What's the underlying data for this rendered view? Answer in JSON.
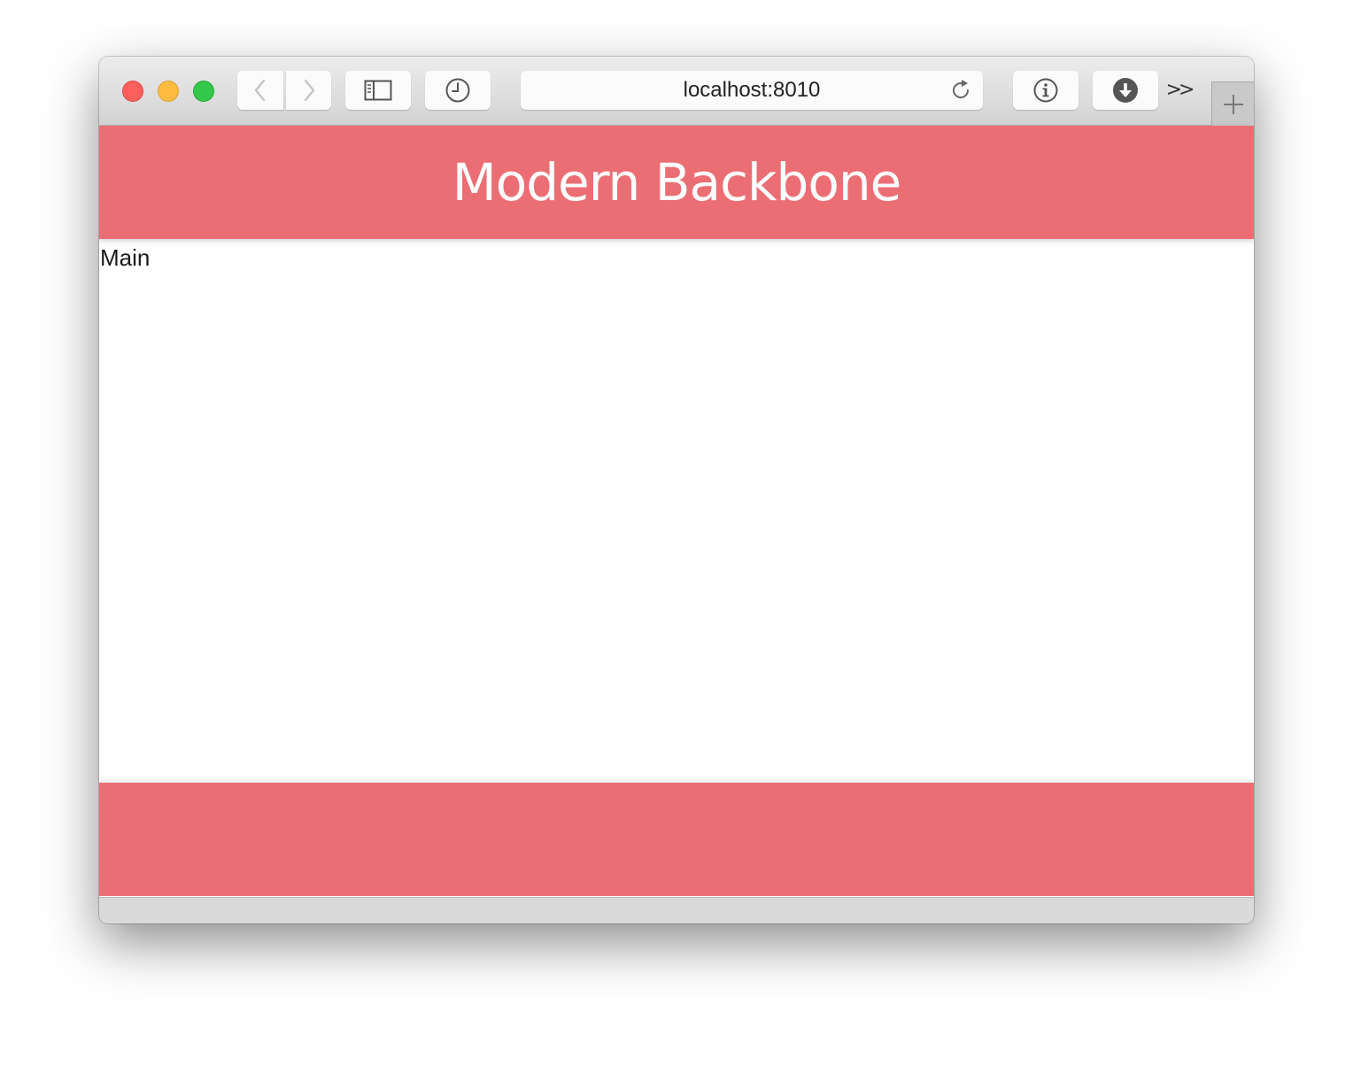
{
  "browser": {
    "url": "localhost:8010",
    "icons": {
      "back": "chevron-left-icon",
      "forward": "chevron-right-icon",
      "sidebar": "sidebar-icon",
      "history": "clock-icon",
      "reload": "reload-icon",
      "info": "info-icon",
      "download": "download-icon",
      "more": "double-chevron-right-icon",
      "new_tab": "plus-icon"
    },
    "more_label": ">>"
  },
  "app": {
    "title": "Modern Backbone",
    "main_label": "Main",
    "colors": {
      "header": "#eb6e74",
      "footer": "#eb6e74",
      "title_text": "#ffffff",
      "body_bg": "#fefefe"
    }
  }
}
